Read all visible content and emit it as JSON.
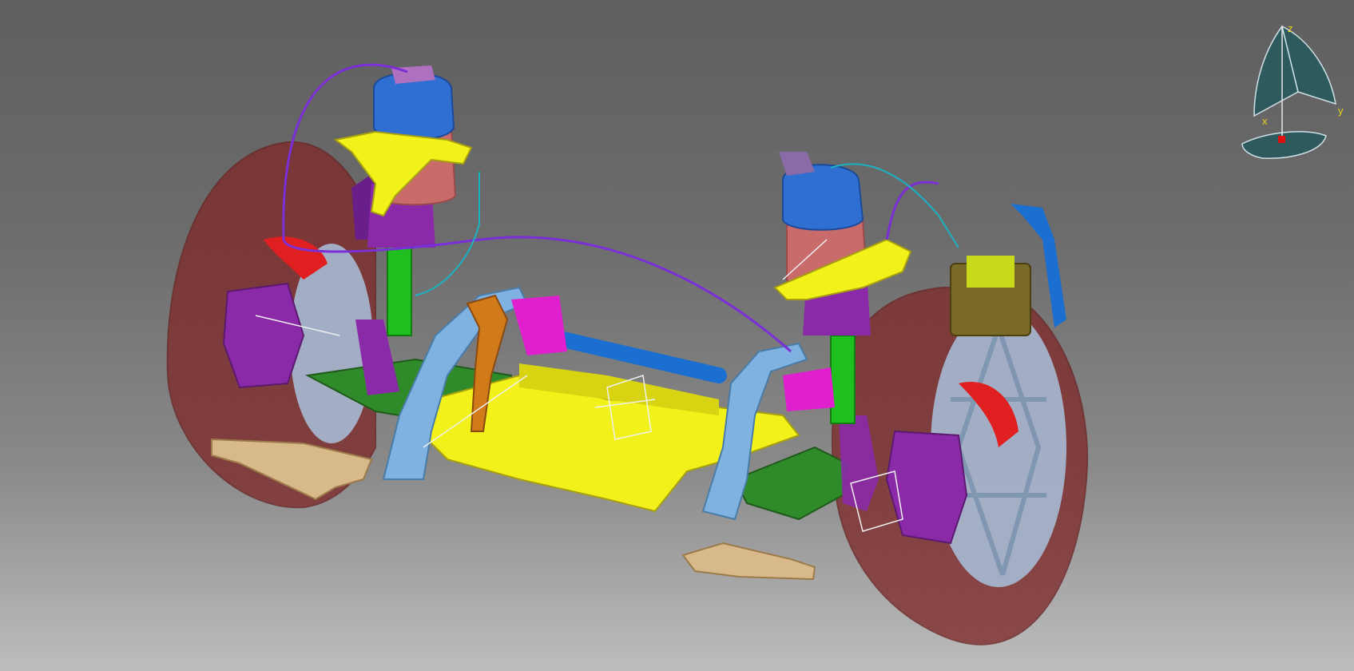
{
  "viewer": {
    "background_top": "#5f5f5f",
    "background_bottom": "#bdbdbd"
  },
  "compass": {
    "axis_x": "x",
    "axis_y": "y",
    "axis_z": "z",
    "label_color": "#e6d21a",
    "face_color": "#2e5a5e"
  },
  "model": {
    "icon": "suspension-assembly-3d-model",
    "tire_color": "#7a2a2a",
    "air_spring_color": "#2f6fd1",
    "bellows_color": "#c96b6b",
    "control_arm_color": "#f2f21a",
    "knuckle_color": "#8b2aa8",
    "strut_color": "#7fb2e0",
    "subframe_color": "#2f8a2a",
    "trailing_arm_color": "#d8b98a",
    "line_color": "#7b2fd6"
  }
}
